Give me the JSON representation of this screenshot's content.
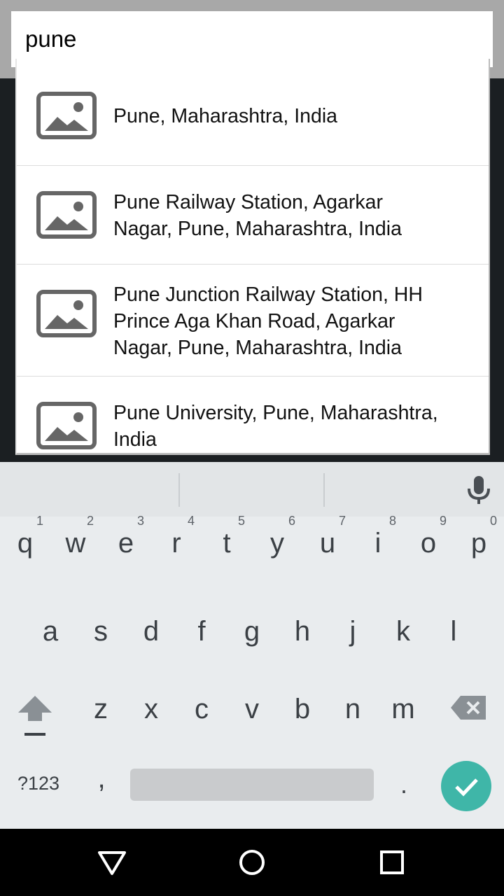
{
  "search": {
    "value": "pune",
    "placeholder": ""
  },
  "suggestions": [
    {
      "lines": [
        "Pune, Maharashtra, India"
      ],
      "icon": "image-placeholder-icon"
    },
    {
      "lines": [
        "Pune Railway Station, Agarkar",
        "Nagar, Pune, Maharashtra, India"
      ],
      "icon": "image-placeholder-icon"
    },
    {
      "lines": [
        "Pune Junction Railway Station, HH",
        "Prince Aga Khan Road, Agarkar",
        "Nagar, Pune, Maharashtra, India"
      ],
      "icon": "image-placeholder-icon"
    },
    {
      "lines": [
        "Pune University, Pune, Maharashtra,",
        "India"
      ],
      "icon": "image-placeholder-icon"
    }
  ],
  "keyboard": {
    "row1": [
      {
        "ch": "q",
        "hint": "1"
      },
      {
        "ch": "w",
        "hint": "2"
      },
      {
        "ch": "e",
        "hint": "3"
      },
      {
        "ch": "r",
        "hint": "4"
      },
      {
        "ch": "t",
        "hint": "5"
      },
      {
        "ch": "y",
        "hint": "6"
      },
      {
        "ch": "u",
        "hint": "7"
      },
      {
        "ch": "i",
        "hint": "8"
      },
      {
        "ch": "o",
        "hint": "9"
      },
      {
        "ch": "p",
        "hint": "0"
      }
    ],
    "row2": [
      "a",
      "s",
      "d",
      "f",
      "g",
      "h",
      "j",
      "k",
      "l"
    ],
    "row3": [
      "z",
      "x",
      "c",
      "v",
      "b",
      "n",
      "m"
    ],
    "symbols_label": "?123",
    "comma": ",",
    "period": "."
  },
  "colors": {
    "accent": "#3fb6a8",
    "keyboard_bg": "#e9ecee",
    "key_text": "#3b4045"
  }
}
